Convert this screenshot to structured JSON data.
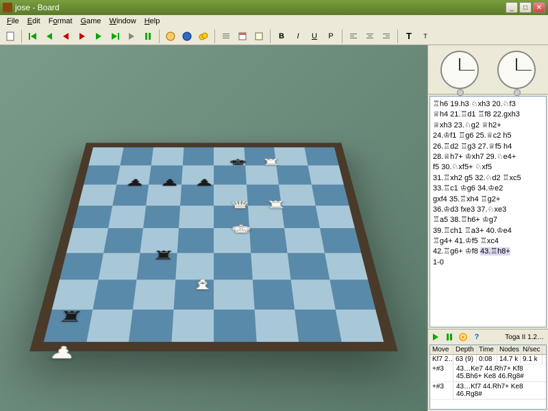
{
  "window": {
    "title": "jose - Board"
  },
  "menu": {
    "file": "File",
    "edit": "Edit",
    "format": "Format",
    "game": "Game",
    "window": "Window",
    "help": "Help"
  },
  "toolbar": {
    "new": "□",
    "first": "⏮",
    "back": "◀",
    "prev": "◁",
    "next": "▶",
    "fwd": "▷",
    "end": "⏭",
    "last": "⏭",
    "play": "▶",
    "pause": "❚❚"
  },
  "board": {
    "pieces": [
      {
        "t": "k",
        "c": "b",
        "f": 4,
        "r": 7
      },
      {
        "t": "r",
        "c": "w",
        "f": 5,
        "r": 7
      },
      {
        "t": "p",
        "c": "b",
        "f": 1,
        "r": 6
      },
      {
        "t": "p",
        "c": "b",
        "f": 2,
        "r": 6
      },
      {
        "t": "p",
        "c": "b",
        "f": 3,
        "r": 6
      },
      {
        "t": "q",
        "c": "w",
        "f": 4,
        "r": 5
      },
      {
        "t": "r",
        "c": "w",
        "f": 5,
        "r": 5
      },
      {
        "t": "k",
        "c": "w",
        "f": 4,
        "r": 4
      },
      {
        "t": "r",
        "c": "b",
        "f": 2,
        "r": 3
      },
      {
        "t": "b",
        "c": "w",
        "f": 3,
        "r": 2
      },
      {
        "t": "r",
        "c": "b",
        "f": 0,
        "r": 1
      },
      {
        "t": "p",
        "c": "w",
        "f": 0,
        "r": 0
      }
    ]
  },
  "notation": {
    "lines": [
      "♖h6 19.h3 ♘xh3 20.♘f3",
      "♕h4 21.♖d1 ♖f8 22.gxh3",
      "♕xh3 23.♘g2 ♕h2+",
      "24.♔f1 ♖g6 25.♕c2 h5",
      "26.♖d2 ♖g3 27.♕f5 h4",
      "28.♕h7+ ♔xh7 29.♘e4+",
      "f5 30.♘xf5+ ♘xf5",
      "31.♖xh2 g5 32.♘d2 ♖xc5",
      "33.♖c1 ♔g6 34.♔e2",
      "gxf4 35.♖xh4 ♖g2+",
      "36.♔d3 fxe3 37.♘xe3",
      "♖a5 38.♖h6+ ♔g7",
      "39.♖ch1 ♖a3+ 40.♔e4",
      "♖g4+ 41.♔f5 ♖xc4",
      "42.♖g6+ ♔f8 "
    ],
    "highlight": "43.♖h8+",
    "result": "1-0"
  },
  "engine": {
    "name": "Toga II 1.2…",
    "headers": {
      "move": "Move",
      "depth": "Depth",
      "time": "Time",
      "nodes": "Nodes",
      "nsec": "N/sec"
    },
    "rows": [
      {
        "move": "Kf7 2…",
        "depth": "63 (9)",
        "time": "0:08",
        "nodes": "14.7 k",
        "nsec": "9.1 k"
      }
    ],
    "pv": [
      {
        "score": "+#3",
        "line": "43…Ke7 44.Rh7+ Kf8 45.Bh6+ Ke8 46.Rg8#"
      },
      {
        "score": "+#3",
        "line": "43…Kf7 44.Rh7+ Ke8 46.Rg8#"
      }
    ]
  }
}
